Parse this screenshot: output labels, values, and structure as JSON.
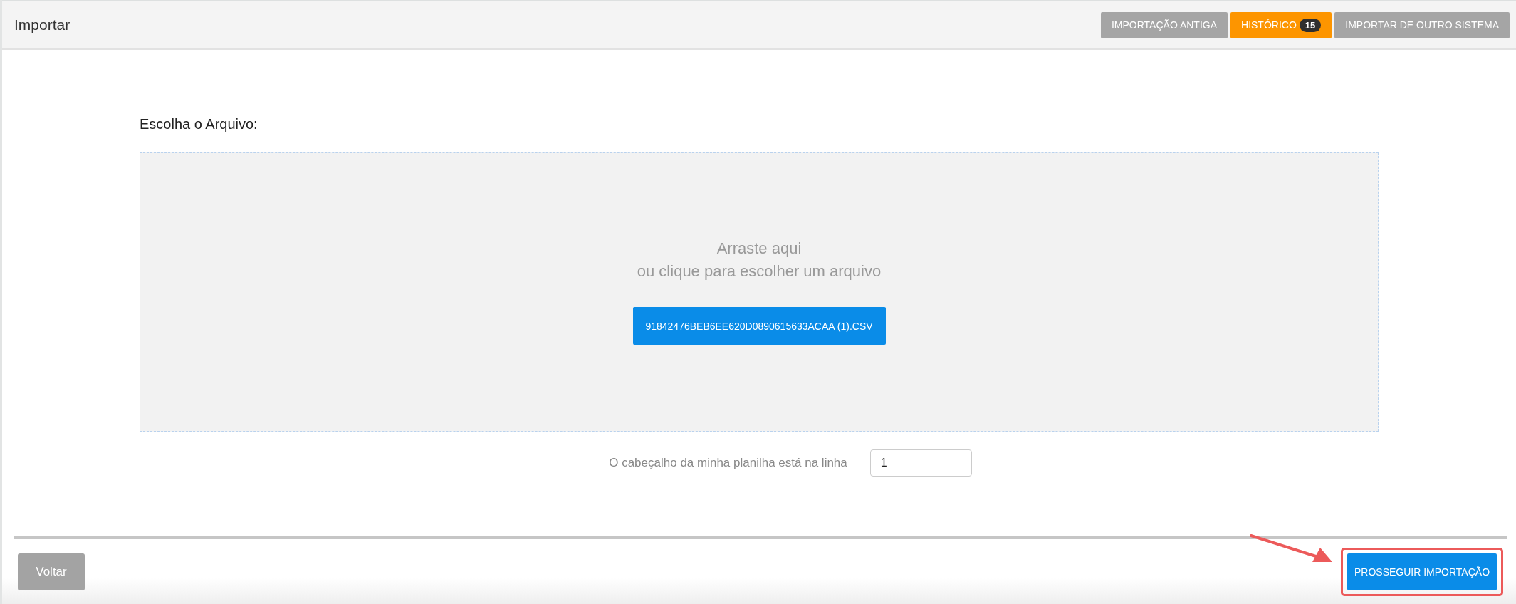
{
  "header": {
    "title": "Importar",
    "tabs": [
      {
        "label": "IMPORTAÇÃO ANTIGA",
        "selected": false
      },
      {
        "label": "HISTÓRICO",
        "selected": true,
        "badge": "15"
      },
      {
        "label": "IMPORTAR DE OUTRO SISTEMA",
        "selected": false
      }
    ]
  },
  "file_section": {
    "label": "Escolha o Arquivo:",
    "dropzone": {
      "line_1": "Arraste aqui",
      "line_2": "ou clique para escolher um arquivo",
      "file_button": "91842476BEB6EE620D0890615633ACAA (1).CSV"
    },
    "header_row": {
      "label": "O cabeçalho da minha planilha está na linha",
      "value": "1"
    }
  },
  "footer": {
    "back_button": "Voltar",
    "proceed_button": "PROSSEGUIR IMPORTAÇÃO",
    "proceed_highlighted": true
  }
}
